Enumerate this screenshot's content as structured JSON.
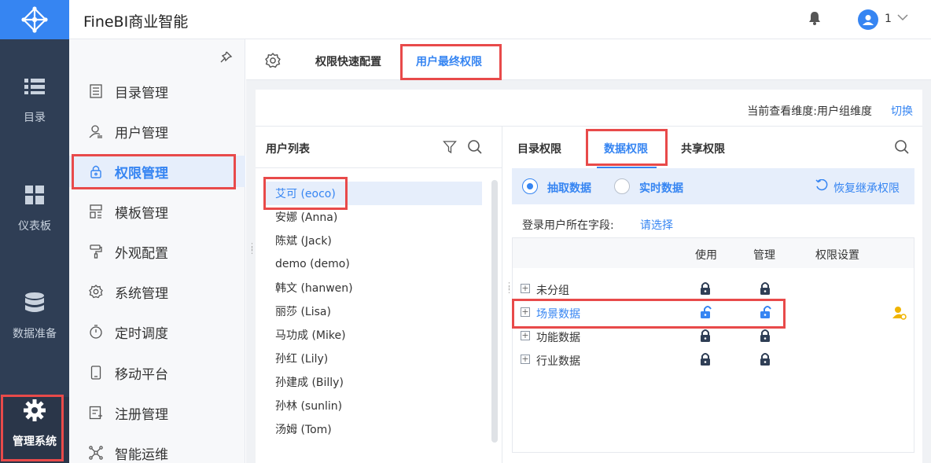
{
  "app": {
    "title": "FineBI商业智能"
  },
  "header": {
    "user_name": "1"
  },
  "rail": {
    "items": [
      {
        "label": "目录",
        "icon": "list-icon"
      },
      {
        "label": "仪表板",
        "icon": "dashboard-icon"
      },
      {
        "label": "数据准备",
        "icon": "database-icon"
      },
      {
        "label": "管理系统",
        "icon": "gear-icon",
        "active": true
      }
    ]
  },
  "menu": {
    "items": [
      {
        "label": "目录管理",
        "icon": "catalog-icon"
      },
      {
        "label": "用户管理",
        "icon": "user-icon"
      },
      {
        "label": "权限管理",
        "icon": "lock-icon",
        "active": true
      },
      {
        "label": "模板管理",
        "icon": "template-icon"
      },
      {
        "label": "外观配置",
        "icon": "paint-roller-icon"
      },
      {
        "label": "系统管理",
        "icon": "settings-icon"
      },
      {
        "label": "定时调度",
        "icon": "timer-icon"
      },
      {
        "label": "移动平台",
        "icon": "mobile-icon"
      },
      {
        "label": "注册管理",
        "icon": "register-icon"
      },
      {
        "label": "智能运维",
        "icon": "network-icon"
      }
    ]
  },
  "tabs": {
    "quick_config": "权限快速配置",
    "final_permission": "用户最终权限"
  },
  "dimension": {
    "current": "当前查看维度:用户组维度",
    "switch": "切换"
  },
  "user_list": {
    "title": "用户列表",
    "users": [
      "艾可 (eoco)",
      "安娜 (Anna)",
      "陈斌 (Jack)",
      "demo (demo)",
      "韩文 (hanwen)",
      "丽莎 (Lisa)",
      "马功成 (Mike)",
      "孙红 (Lily)",
      "孙建成 (Billy)",
      "孙林 (sunlin)",
      "汤姆 (Tom)"
    ]
  },
  "perm_tabs": {
    "catalog": "目录权限",
    "data": "数据权限",
    "share": "共享权限"
  },
  "mode": {
    "extract": "抽取数据",
    "realtime": "实时数据",
    "restore": "恢复继承权限"
  },
  "login_field": {
    "label": "登录用户所在字段:",
    "select": "请选择"
  },
  "table": {
    "headers": {
      "use": "使用",
      "manage": "管理",
      "settings": "权限设置"
    },
    "rows": [
      {
        "label": "未分组",
        "use": "locked",
        "manage": "locked"
      },
      {
        "label": "场景数据",
        "use": "unlocked",
        "manage": "unlocked"
      },
      {
        "label": "功能数据",
        "use": "locked",
        "manage": "locked"
      },
      {
        "label": "行业数据",
        "use": "locked",
        "manage": "locked"
      }
    ]
  },
  "colors": {
    "accent": "#3685f2",
    "rail_bg": "#2f3e55",
    "highlight": "#e84a4a"
  }
}
